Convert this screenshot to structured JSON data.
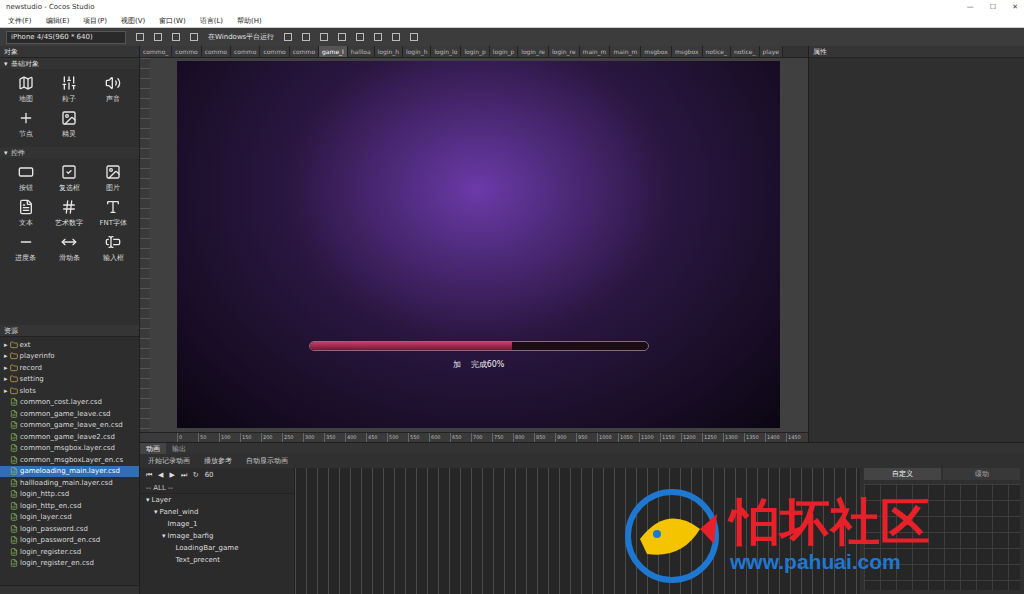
{
  "window": {
    "title": "newstudio - Cocos Studio",
    "controls": [
      "—",
      "☐",
      "✕"
    ]
  },
  "menu": [
    "文件(F)",
    "编辑(E)",
    "项目(P)",
    "视图(V)",
    "窗口(W)",
    "语言(L)",
    "帮助(H)"
  ],
  "toolbar": {
    "device": "iPhone 4/4S(960 * 640)",
    "run": "在Windows平台运行"
  },
  "file_tabs": [
    {
      "label": "commo_",
      "selected": false
    },
    {
      "label": "commo",
      "selected": false
    },
    {
      "label": "commo",
      "selected": false
    },
    {
      "label": "commo",
      "selected": false
    },
    {
      "label": "commo",
      "selected": false
    },
    {
      "label": "commo",
      "selected": false
    },
    {
      "label": "game_l",
      "selected": true
    },
    {
      "label": "hallloa",
      "selected": false
    },
    {
      "label": "login_h",
      "selected": false
    },
    {
      "label": "login_h",
      "selected": false
    },
    {
      "label": "login_lo",
      "selected": false
    },
    {
      "label": "login_p",
      "selected": false
    },
    {
      "label": "login_p",
      "selected": false
    },
    {
      "label": "login_re",
      "selected": false
    },
    {
      "label": "login_re",
      "selected": false
    },
    {
      "label": "main_m",
      "selected": false
    },
    {
      "label": "main_m",
      "selected": false
    },
    {
      "label": "msgbox",
      "selected": false
    },
    {
      "label": "msgbox",
      "selected": false
    },
    {
      "label": "notice_",
      "selected": false
    },
    {
      "label": "notice_",
      "selected": false
    },
    {
      "label": "playe",
      "selected": false
    }
  ],
  "object_panel": {
    "title": "对象",
    "sections": [
      {
        "title": "基础对象",
        "expanded": true,
        "items": [
          "地图",
          "粒子",
          "声音",
          "节点",
          "精灵"
        ]
      },
      {
        "title": "控件",
        "expanded": true,
        "items": [
          "按钮",
          "复选框",
          "图片",
          "文本",
          "艺术数字",
          "FNT字体",
          "进度条",
          "滑动条",
          "输入框"
        ]
      }
    ]
  },
  "resources": {
    "title": "资源",
    "items": [
      {
        "label": "ext",
        "kind": "folder",
        "selected": false
      },
      {
        "label": "playerinfo",
        "kind": "folder",
        "selected": false
      },
      {
        "label": "record",
        "kind": "folder",
        "selected": false
      },
      {
        "label": "setting",
        "kind": "folder",
        "selected": false
      },
      {
        "label": "slots",
        "kind": "folder",
        "selected": false
      },
      {
        "label": "common_cost.layer.csd",
        "kind": "file",
        "selected": false
      },
      {
        "label": "common_game_leave.csd",
        "kind": "file",
        "selected": false
      },
      {
        "label": "common_game_leave_en.csd",
        "kind": "file",
        "selected": false
      },
      {
        "label": "common_game_leave2.csd",
        "kind": "file",
        "selected": false
      },
      {
        "label": "common_msgbox.layer.csd",
        "kind": "file",
        "selected": false
      },
      {
        "label": "common_msgboxLayer_en.cs",
        "kind": "file",
        "selected": false
      },
      {
        "label": "gameloading_main.layer.csd",
        "kind": "file",
        "selected": true
      },
      {
        "label": "hallloading_main.layer.csd",
        "kind": "file",
        "selected": false
      },
      {
        "label": "login_http.csd",
        "kind": "file",
        "selected": false
      },
      {
        "label": "login_http_en.csd",
        "kind": "file",
        "selected": false
      },
      {
        "label": "login_layer.csd",
        "kind": "file",
        "selected": false
      },
      {
        "label": "login_password.csd",
        "kind": "file",
        "selected": false
      },
      {
        "label": "login_password_en.csd",
        "kind": "file",
        "selected": false
      },
      {
        "label": "login_register.csd",
        "kind": "file",
        "selected": false
      },
      {
        "label": "login_register_en.csd",
        "kind": "file",
        "selected": false
      }
    ]
  },
  "properties": {
    "title": "属性"
  },
  "canvas": {
    "loading": {
      "level": 0.6,
      "text": "加    完成60%"
    }
  },
  "ruler": {
    "ticks": [
      "0",
      "50",
      "100",
      "150",
      "200",
      "250",
      "300",
      "350",
      "400",
      "450",
      "500",
      "550",
      "600",
      "650",
      "700",
      "750",
      "800",
      "850",
      "900",
      "950",
      "1000",
      "1050",
      "1100",
      "1150",
      "1200",
      "1250",
      "1300",
      "1350",
      "1400",
      "1450"
    ]
  },
  "timeline": {
    "tabs": [
      {
        "label": "动画",
        "selected": true
      },
      {
        "label": "输出",
        "selected": false
      }
    ],
    "record": "开始记录动画",
    "play_ref": "播放参考",
    "auto_show": "自动显示动画",
    "transport": [
      "⏮",
      "◀",
      "▶",
      "⏭",
      "↻"
    ],
    "fps": "60",
    "filter": "-- ALL --",
    "nodes": [
      {
        "label": "Layer",
        "depth": 0,
        "expanded": true,
        "has_children": true
      },
      {
        "label": "Panel_wind",
        "depth": 1,
        "expanded": true,
        "has_children": true
      },
      {
        "label": "Image_1",
        "depth": 2,
        "expanded": false,
        "has_children": false
      },
      {
        "label": "Image_barfig",
        "depth": 2,
        "expanded": true,
        "has_children": true
      },
      {
        "label": "LoadingBar_game",
        "depth": 3,
        "expanded": false,
        "has_children": false
      },
      {
        "label": "Text_precent",
        "depth": 3,
        "expanded": false,
        "has_children": false
      }
    ]
  },
  "curve": {
    "tabs": [
      {
        "label": "自定义",
        "selected": true
      },
      {
        "label": "缓动",
        "selected": false
      }
    ]
  },
  "watermark": {
    "name": "怕坏社区",
    "url": "www.pahuai.com"
  }
}
